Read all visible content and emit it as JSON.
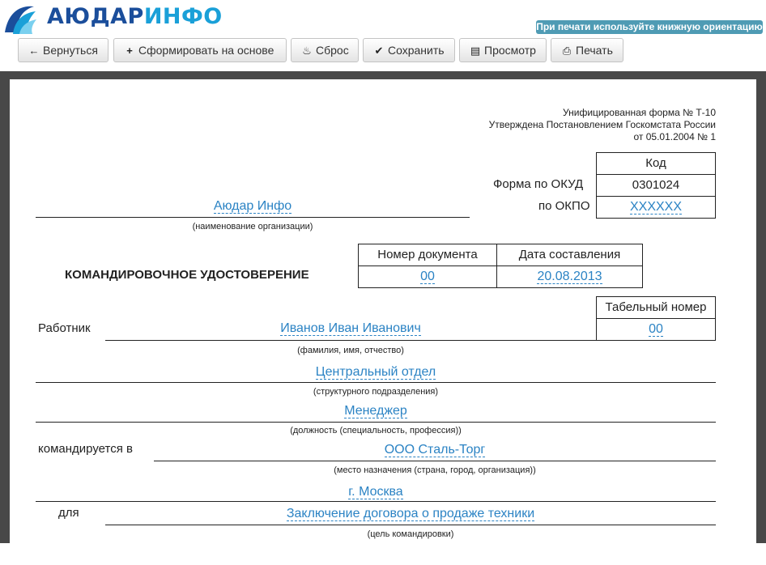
{
  "logo": {
    "part1": "АЮДАР",
    "part2": "ИНФО"
  },
  "print_hint": "При печати используйте книжную ориентацию",
  "toolbar": {
    "back": "Вернуться",
    "create_based": "Сформировать на основе",
    "reset": "Сброс",
    "save": "Сохранить",
    "preview": "Просмотр",
    "print": "Печать"
  },
  "form": {
    "header_line1": "Унифицированная форма № Т-10",
    "header_line2": "Утверждена Постановлением Госкомстата России",
    "header_line3": "от 05.01.2004 № 1",
    "code_label": "Код",
    "okud_label": "Форма по ОКУД",
    "okud_value": "0301024",
    "okpo_label": "по ОКПО",
    "okpo_value": "XXXXXX",
    "org_value": "Аюдар Инфо",
    "org_caption": "(наименование организации)",
    "doc_num_header": "Номер документа",
    "doc_date_header": "Дата составления",
    "doc_num_value": "00",
    "doc_date_value": "20.08.2013",
    "title": "КОМАНДИРОВОЧНОЕ УДОСТОВЕРЕНИЕ",
    "tab_num_header": "Табельный номер",
    "tab_num_value": "00",
    "worker_label": "Работник",
    "worker_value": "Иванов Иван Иванович",
    "worker_caption": "(фамилия, имя, отчество)",
    "dept_value": "Центральный отдел",
    "dept_caption": "(структурного подразделения)",
    "position_value": "Менеджер",
    "position_caption": "(должность (специальность, профессия))",
    "sent_label": "командируется в",
    "destination_value": "ООО Сталь-Торг",
    "destination_caption": "(место назначения (страна, город, организация))",
    "city_value": "г. Москва",
    "purpose_label": "для",
    "purpose_value": "Заключение договора о продаже техники",
    "purpose_caption": "(цель командировки)"
  }
}
